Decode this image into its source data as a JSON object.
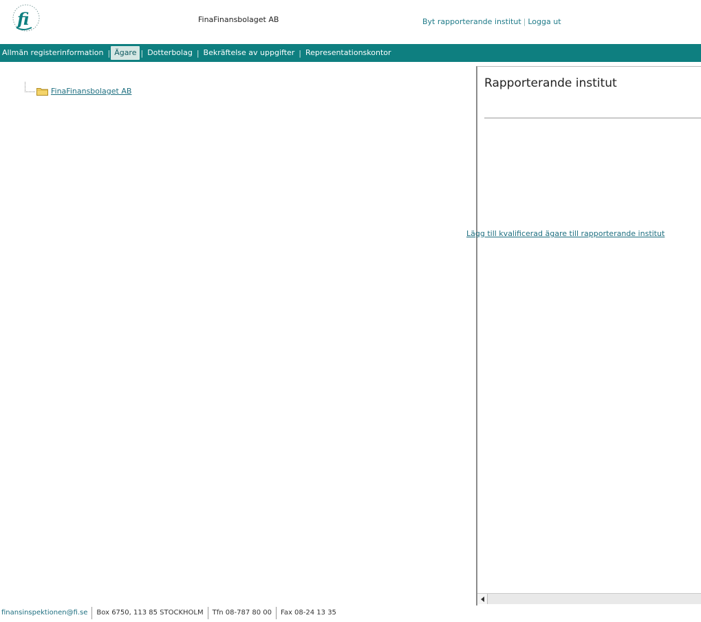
{
  "header": {
    "company": "FinaFinansbolaget AB",
    "switch_link": "Byt rapporterande institut",
    "separator": "|",
    "logout_link": "Logga ut"
  },
  "nav": {
    "items": [
      {
        "label": "Allmän registerinformation",
        "active": false
      },
      {
        "label": "Ägare",
        "active": true
      },
      {
        "label": "Dotterbolag",
        "active": false
      },
      {
        "label": "Bekräftelse av uppgifter",
        "active": false
      },
      {
        "label": "Representationskontor",
        "active": false
      }
    ],
    "separator": "|"
  },
  "tree": {
    "root_label": "FinaFinansbolaget AB",
    "icon": "folder-icon"
  },
  "right_panel": {
    "title": "Rapporterande institut",
    "add_link": "Lägg till kvalificerad ägare till rapporterande institut"
  },
  "footer": {
    "email": "finansinspektionen@fi.se",
    "address": "Box 6750, 113 85 STOCKHOLM",
    "phone": "Tfn 08-787 80 00",
    "fax": "Fax 08-24 13 35"
  },
  "colors": {
    "nav_bg": "#0e7f80",
    "link": "#1e6f80"
  }
}
